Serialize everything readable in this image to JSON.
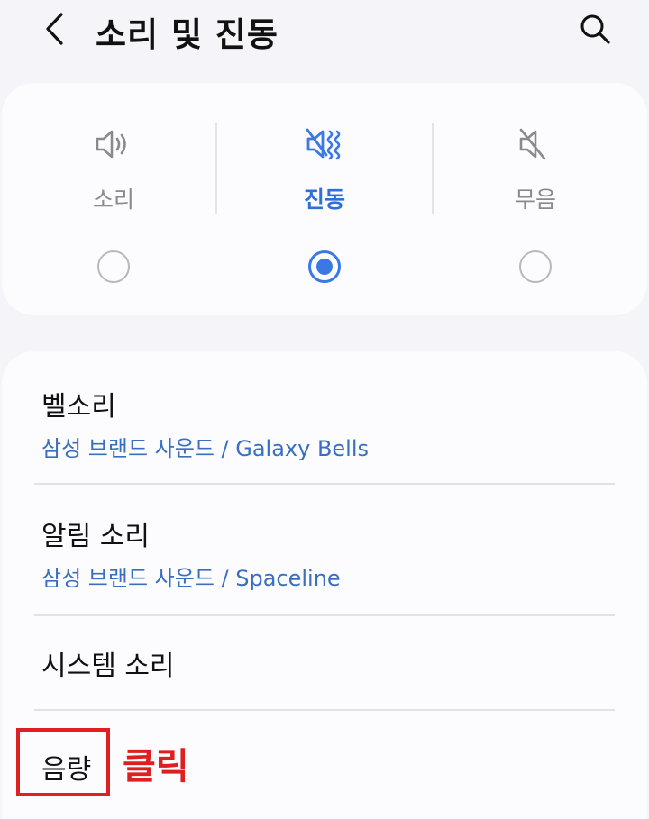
{
  "header": {
    "title": "소리 및 진동"
  },
  "modes": [
    {
      "label": "소리",
      "icon": "speaker-icon",
      "selected": false
    },
    {
      "label": "진동",
      "icon": "vibrate-icon",
      "selected": true
    },
    {
      "label": "무음",
      "icon": "mute-icon",
      "selected": false
    }
  ],
  "settings": {
    "ringtone": {
      "label": "벨소리",
      "value": "삼성 브랜드 사운드 / Galaxy Bells"
    },
    "notification": {
      "label": "알림 소리",
      "value": "삼성 브랜드 사운드 / Spaceline"
    },
    "system": {
      "label": "시스템 소리"
    },
    "volume": {
      "label": "음량"
    }
  },
  "annotation": {
    "text": "클릭",
    "color": "#dd1f1f"
  },
  "colors": {
    "accent": "#3a78e6",
    "subtext": "#3a6fc0",
    "background": "#f5f5f9"
  }
}
